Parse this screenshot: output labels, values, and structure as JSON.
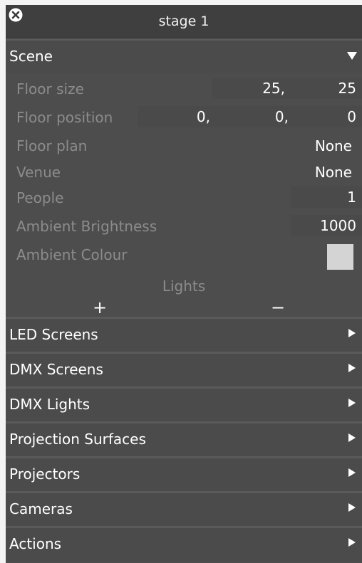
{
  "window": {
    "title": "stage 1"
  },
  "scene": {
    "header": "Scene",
    "floor_size": {
      "label": "Floor size",
      "x": "25,",
      "y": "25"
    },
    "floor_position": {
      "label": "Floor position",
      "x": "0,",
      "y": "0,",
      "z": "0"
    },
    "floor_plan": {
      "label": "Floor plan",
      "value": "None"
    },
    "venue": {
      "label": "Venue",
      "value": "None"
    },
    "people": {
      "label": "People",
      "value": "1"
    },
    "ambient_brightness": {
      "label": "Ambient Brightness",
      "value": "1000"
    },
    "ambient_colour": {
      "label": "Ambient Colour",
      "swatch": "#d4d4d4"
    },
    "lights": {
      "label": "Lights",
      "add": "+",
      "remove": "−"
    }
  },
  "sections": {
    "led_screens": "LED Screens",
    "dmx_screens": "DMX Screens",
    "dmx_lights": "DMX Lights",
    "projection_surfaces": "Projection Surfaces",
    "projectors": "Projectors",
    "cameras": "Cameras",
    "actions": "Actions"
  },
  "icons": {
    "close": "close-icon",
    "expand": "chevron-down-icon",
    "collapsed": "chevron-right-icon"
  },
  "colors": {
    "panel": "#4d4d4d",
    "titlebar": "#3f3f3f",
    "label_muted": "#8c8c8c",
    "text": "#ffffff"
  }
}
